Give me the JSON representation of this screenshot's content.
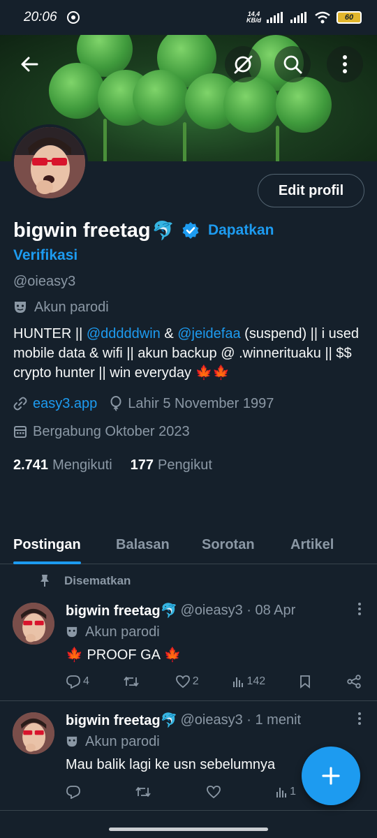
{
  "status_bar": {
    "time": "20:06",
    "speed_top": "14,4",
    "speed_bottom": "KB/d",
    "battery": "60"
  },
  "profile": {
    "name": "bigwin freetag",
    "name_emoji": "🐬",
    "get_verified_1": "Dapatkan",
    "get_verified_2": "Verifikasi",
    "handle": "@oieasy3",
    "parody_label": "Akun parodi",
    "edit_button": "Edit profil",
    "bio": {
      "p1": "HUNTER || ",
      "mention1": "@dddddwin",
      "p2": " & ",
      "mention2": "@jeidefaa",
      "p3": " (suspend) || i used mobile data & wifi || akun backup @ .winnerituaku || $$ crypto hunter || win everyday 🍁🍁"
    },
    "website": "easy3.app",
    "birthday": "Lahir 5 November 1997",
    "joined": "Bergabung Oktober 2023",
    "following_count": "2.741",
    "following_label": "Mengikuti",
    "followers_count": "177",
    "followers_label": "Pengikut"
  },
  "tabs": [
    "Postingan",
    "Balasan",
    "Sorotan",
    "Artikel"
  ],
  "pinned_label": "Disematkan",
  "tweets": [
    {
      "name": "bigwin freetag🐬",
      "handle": "@oieasy3 · 08 Apr",
      "parody": "Akun parodi",
      "text": "🍁 PROOF GA 🍁",
      "replies": "4",
      "retweets": "",
      "likes": "2",
      "views": "142"
    },
    {
      "name": "bigwin freetag🐬",
      "handle": "@oieasy3 · 1 menit",
      "parody": "Akun parodi",
      "text": "Mau balik lagi ke usn sebelumnya",
      "replies": "",
      "retweets": "",
      "likes": "",
      "views": "1"
    }
  ],
  "colors": {
    "background": "#15202b",
    "accent": "#1d9bf0",
    "muted": "#8b98a5",
    "border": "#38444d"
  }
}
